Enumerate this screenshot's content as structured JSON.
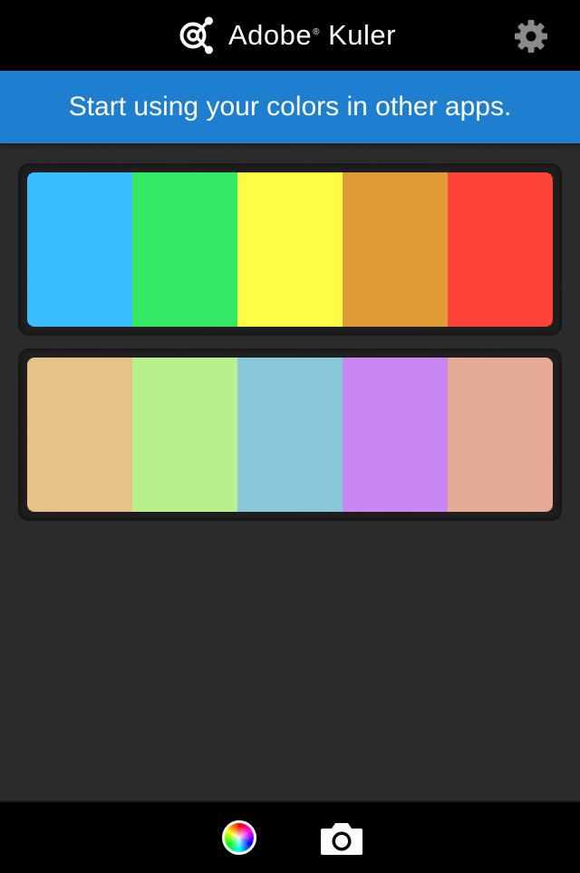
{
  "header": {
    "app_name_prefix": "Adobe",
    "registered_mark": "®",
    "app_name_suffix": " Kuler",
    "logo_icon": "kuler-logo-icon",
    "settings_icon": "gear-icon"
  },
  "banner": {
    "text": "Start using your colors in other apps."
  },
  "themes": [
    {
      "colors": [
        "#38beff",
        "#33e863",
        "#fffc46",
        "#e19b34",
        "#fe4438"
      ]
    },
    {
      "colors": [
        "#e6c286",
        "#b8f08e",
        "#88c8d8",
        "#c887f1",
        "#e6ab94"
      ]
    }
  ],
  "toolbar": {
    "color_wheel_icon": "color-wheel-icon",
    "camera_icon": "camera-icon"
  },
  "colors": {
    "header_bg": "#000000",
    "banner_bg": "#1e7fd0",
    "page_bg": "#2a2a2a"
  }
}
